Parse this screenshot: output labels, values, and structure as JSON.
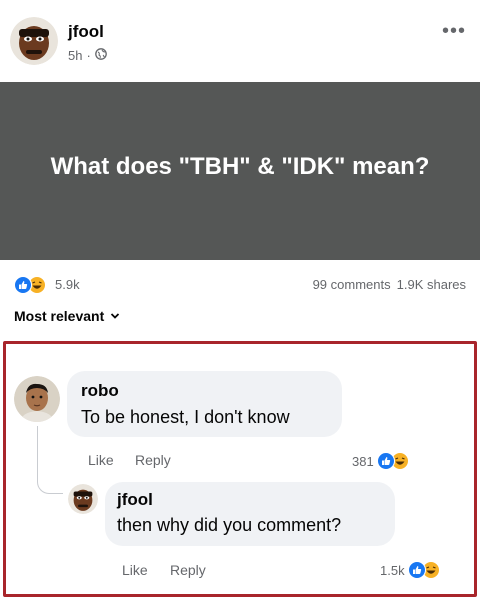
{
  "post": {
    "author": "jfool",
    "time": "5h",
    "dot": "·",
    "more_label": "•••",
    "text": "What does \"TBH\" & \"IDK\" mean?",
    "reaction_count": "5.9k",
    "comments": "99 comments",
    "shares": "1.9K shares"
  },
  "sort": {
    "label": "Most relevant"
  },
  "comments": [
    {
      "author": "robo",
      "text": "To be honest, I don't know",
      "like_label": "Like",
      "reply_label": "Reply",
      "reactions": "381"
    },
    {
      "author": "jfool",
      "text": "then why did you comment?",
      "like_label": "Like",
      "reply_label": "Reply",
      "reactions": "1.5k"
    }
  ],
  "colors": {
    "like_blue": "#1877f2",
    "haha_yellow": "#f7b125",
    "frame_red": "#a8252b",
    "post_bg": "#555756"
  }
}
